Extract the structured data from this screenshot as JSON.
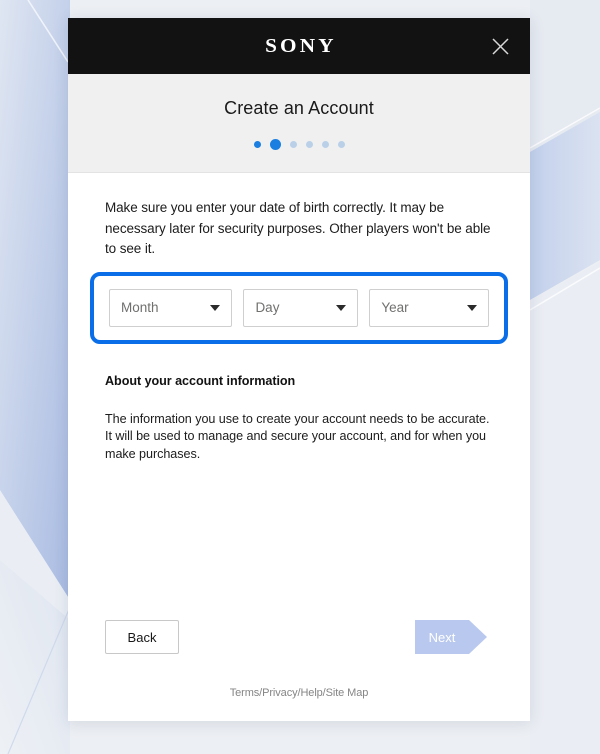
{
  "window": {
    "brand": "SONY",
    "close_icon": "close-icon"
  },
  "header": {
    "title": "Create an Account",
    "progress": {
      "total_steps": 6,
      "current_step": 2,
      "completed_color": "#1a7fe0",
      "upcoming_color": "#b9d0e8"
    }
  },
  "main": {
    "intro_text": "Make sure you enter your date of birth correctly. It may be necessary later for security purposes. Other players won't be able to see it.",
    "dob": {
      "focused": true,
      "focus_ring_color": "#0a6ee8",
      "fields": [
        {
          "name": "month",
          "placeholder": "Month",
          "value": ""
        },
        {
          "name": "day",
          "placeholder": "Day",
          "value": ""
        },
        {
          "name": "year",
          "placeholder": "Year",
          "value": ""
        }
      ]
    },
    "about": {
      "heading": "About your account information",
      "line1": "The information you use to create your account needs to be accurate.",
      "line2": "It will be used to manage and secure your account, and for when you make purchases."
    }
  },
  "actions": {
    "back_label": "Back",
    "next_label": "Next",
    "next_disabled": true,
    "next_color": "#b9c8ee"
  },
  "footer": {
    "links_text": "Terms/Privacy/Help/Site Map"
  }
}
